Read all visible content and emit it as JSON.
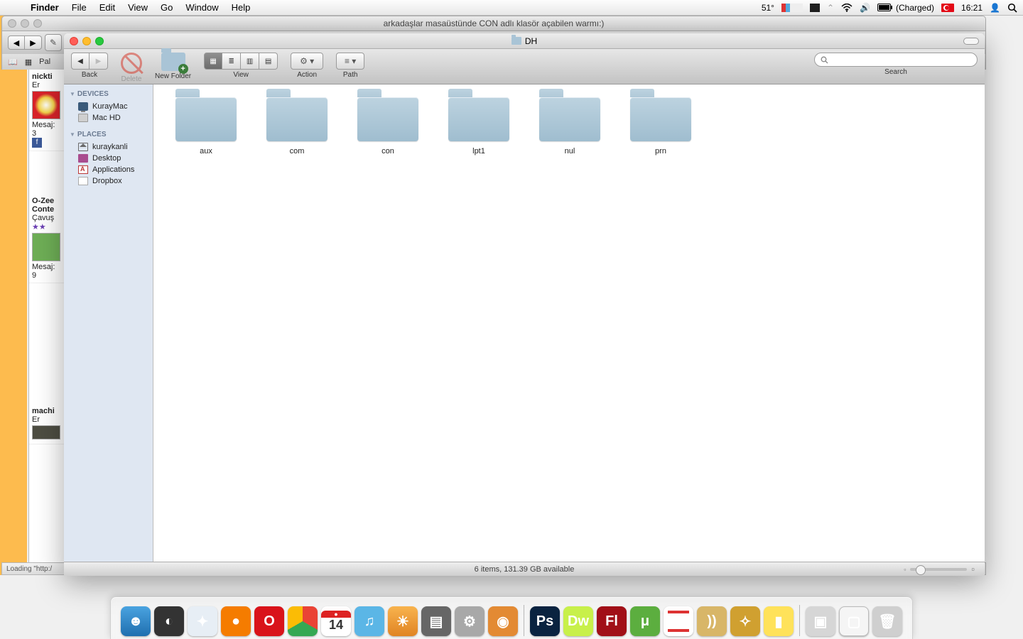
{
  "menubar": {
    "app": "Finder",
    "items": [
      "File",
      "Edit",
      "View",
      "Go",
      "Window",
      "Help"
    ],
    "temp": "51°",
    "battery": "(Charged)",
    "clock": "16:21"
  },
  "safari": {
    "title": "arkadaşlar masaüstünde CON adlı klasör açabilen warmı:)",
    "bookmark_prefix": "Pal",
    "loading": "Loading \"http:/",
    "thread": {
      "post1_name": "nickti",
      "post1_rank": "Er",
      "post1_meta": "Mesaj: 3",
      "post2_name": "O-Zee",
      "post2_name2": "Conte",
      "post2_rank": "Çavuş",
      "post2_meta": "Mesaj: 9",
      "post3_name": "machi",
      "post3_rank": "Er"
    }
  },
  "finder": {
    "title": "DH",
    "toolbar": {
      "back": "Back",
      "delete": "Delete",
      "newfolder": "New Folder",
      "view": "View",
      "action": "Action",
      "path": "Path",
      "search": "Search"
    },
    "sidebar": {
      "devices_label": "DEVICES",
      "devices": [
        "KurayMac",
        "Mac HD"
      ],
      "places_label": "PLACES",
      "places": [
        "kuraykanli",
        "Desktop",
        "Applications",
        "Dropbox"
      ]
    },
    "folders": [
      "aux",
      "com",
      "con",
      "lpt1",
      "nul",
      "prn"
    ],
    "status": "6 items, 131.39 GB available"
  },
  "dock": {
    "ical_day": "14"
  }
}
